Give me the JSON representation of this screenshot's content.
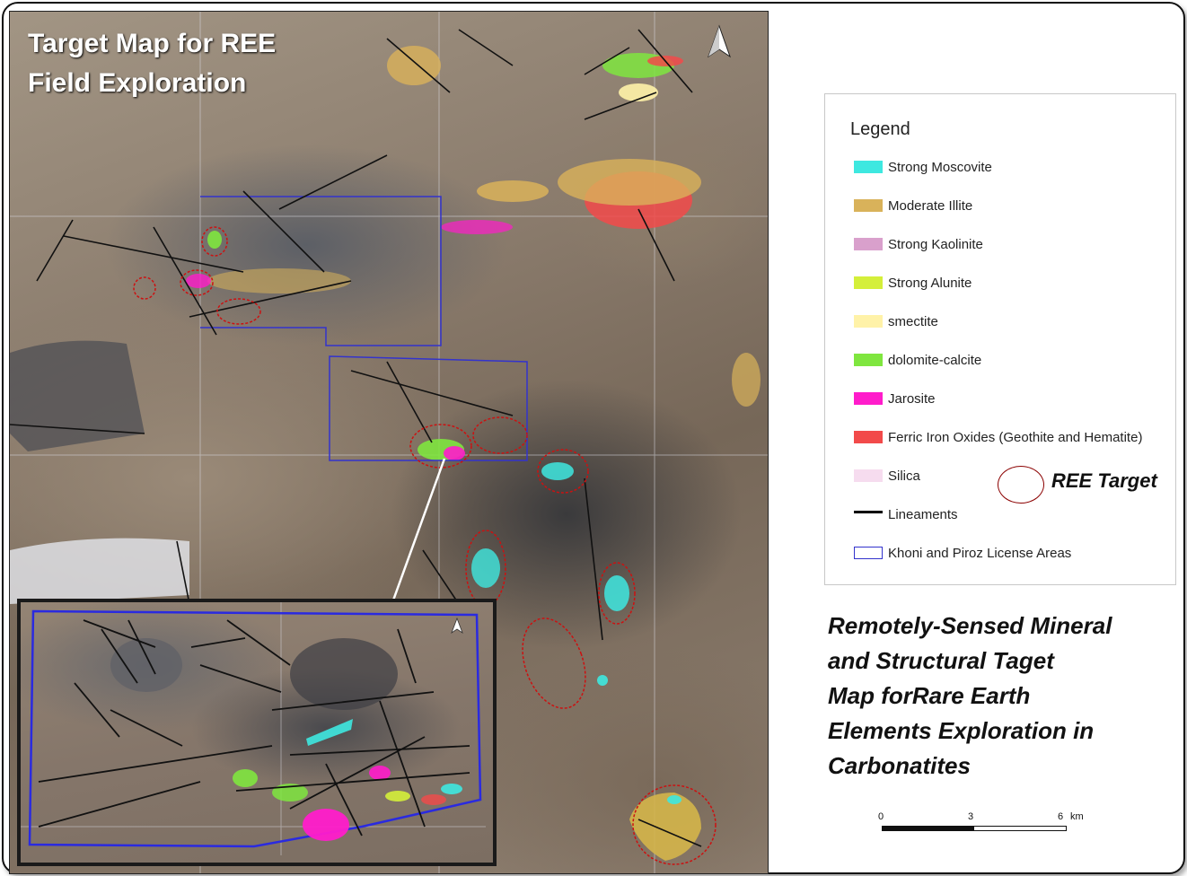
{
  "map": {
    "title_line1": "Target Map for REE",
    "title_line2": "Field Exploration",
    "north_arrow_icon": "north-arrow-icon"
  },
  "legend": {
    "title": "Legend",
    "items": [
      {
        "label": "Strong Moscovite",
        "color": "#3ee8e0"
      },
      {
        "label": "Moderate Illite",
        "color": "#d9b25a"
      },
      {
        "label": "Strong Kaolinite",
        "color": "#d9a0cc"
      },
      {
        "label": "Strong Alunite",
        "color": "#d4ef3a"
      },
      {
        "label": "smectite",
        "color": "#fff2a8"
      },
      {
        "label": "dolomite-calcite",
        "color": "#7fe63f"
      },
      {
        "label": "Jarosite",
        "color": "#ff1ccb"
      },
      {
        "label": "Ferric Iron Oxides (Geothite and Hematite)",
        "color": "#f24a4a"
      },
      {
        "label": "Silica",
        "color": "#f6dcef"
      },
      {
        "label": "Lineaments",
        "color": "#000000"
      },
      {
        "label": "Khoni and Piroz  License Areas",
        "color": "#3333cc"
      }
    ],
    "ree_target_label": "REE Target"
  },
  "description": {
    "lines": [
      "Remotely-Sensed Mineral",
      "and Structural  Taget",
      "Map forRare Earth",
      "Elements Exploration in",
      "Carbonatites"
    ]
  },
  "scale": {
    "tick_0": "0",
    "tick_3": "3",
    "tick_6": "6",
    "unit": "km"
  }
}
